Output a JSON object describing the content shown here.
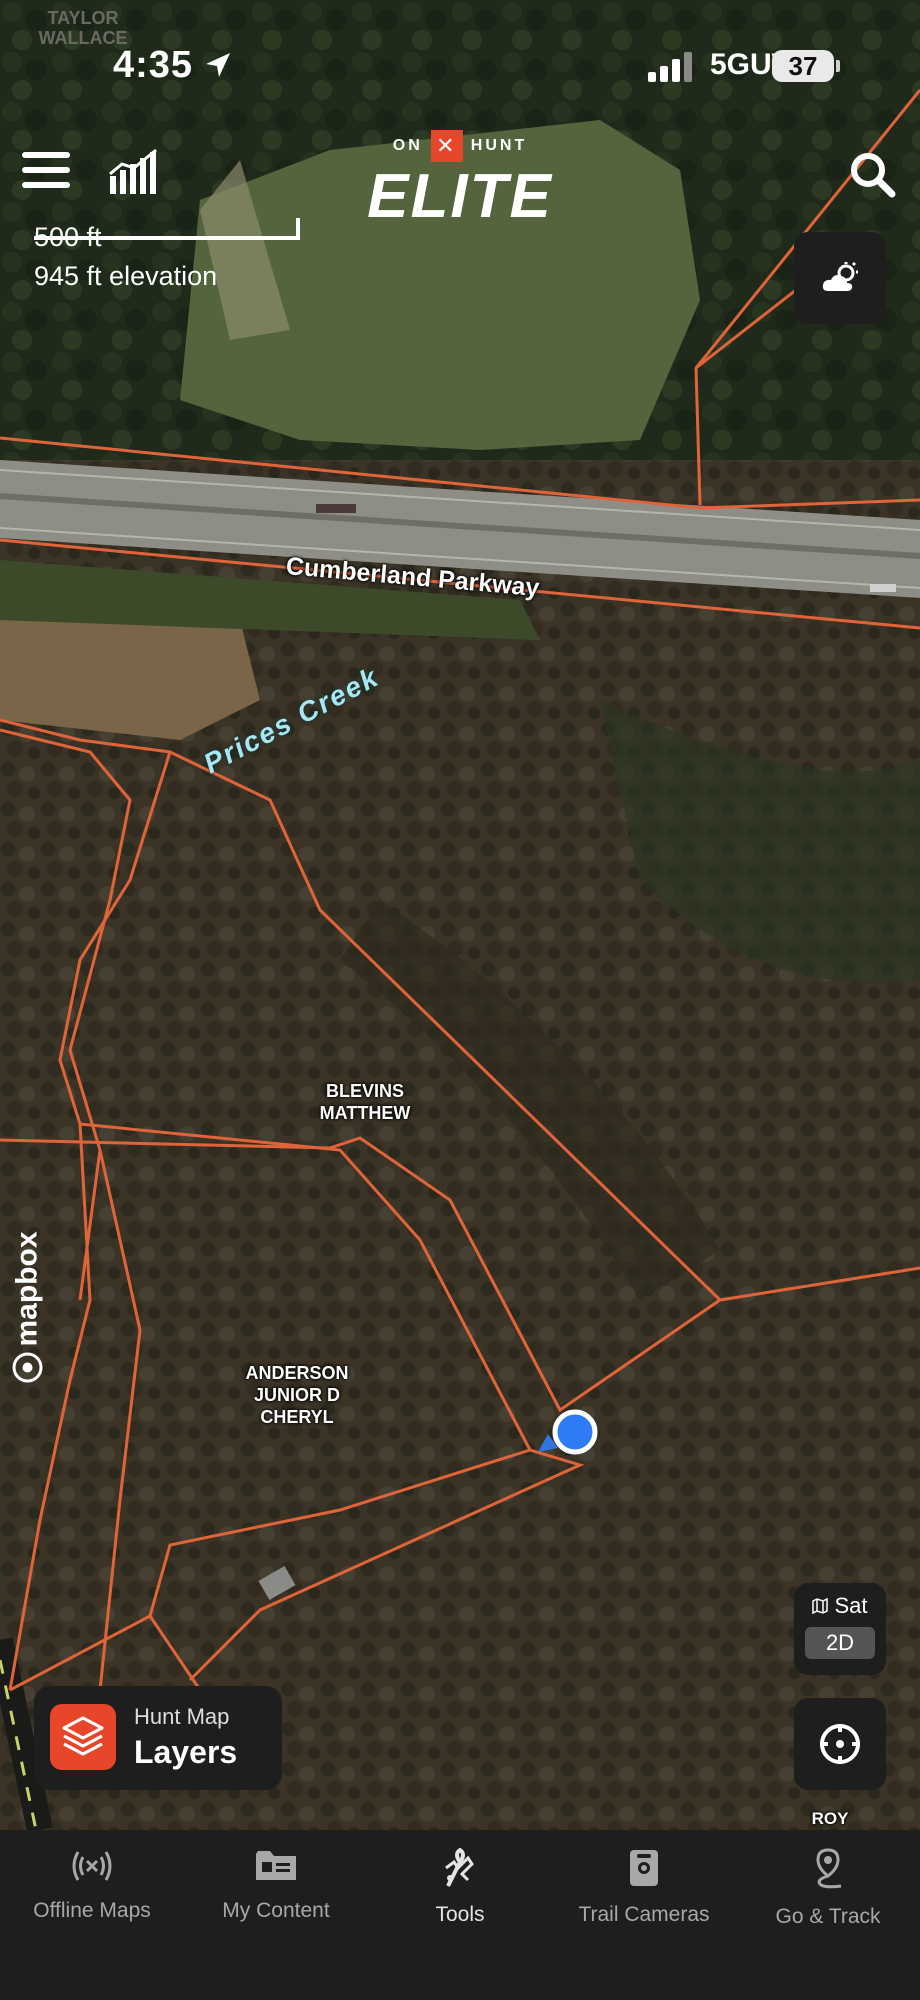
{
  "status_bar": {
    "time": "4:35",
    "network": "5GUW",
    "battery": "37"
  },
  "watermark": "TAYLOR WALLACE",
  "brand": {
    "top_left": "ON",
    "top_right": "HUNT",
    "x_mark": "✕",
    "name": "ELITE"
  },
  "scale": {
    "distance": "500 ft",
    "elevation": "945 ft elevation"
  },
  "map_labels": {
    "road": "Cumberland Parkway",
    "creek": "Prices Creek",
    "owners": [
      "BLEVINS MATTHEW",
      "ANDERSON JUNIOR D CHERYL",
      "ROY"
    ]
  },
  "attribution": "mapbox",
  "map_style": {
    "base": "Sat",
    "mode": "2D"
  },
  "layers_card": {
    "subtitle": "Hunt Map",
    "title": "Layers"
  },
  "tabbar": [
    {
      "label": "Offline Maps",
      "icon": "offline-signal-icon"
    },
    {
      "label": "My Content",
      "icon": "folder-icon"
    },
    {
      "label": "Tools",
      "icon": "tools-icon"
    },
    {
      "label": "Trail Cameras",
      "icon": "trail-camera-icon"
    },
    {
      "label": "Go & Track",
      "icon": "location-track-icon"
    }
  ],
  "colors": {
    "accent": "#e8462a",
    "parcel_line": "#e0643a",
    "location_dot": "#2f7bf5",
    "panel": "#1e1e1e"
  }
}
